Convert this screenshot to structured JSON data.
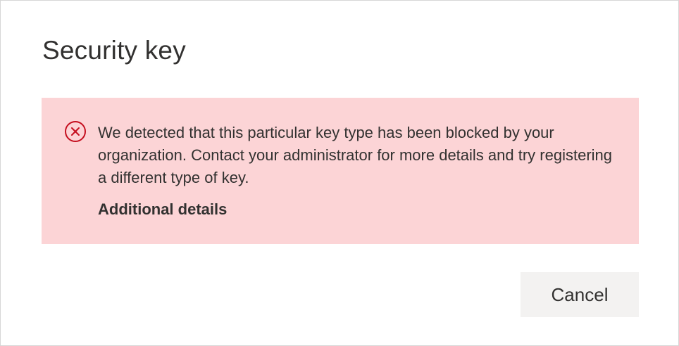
{
  "dialog": {
    "title": "Security key",
    "error": {
      "icon": "error-circle-x-icon",
      "color": "#c50f1f",
      "background": "#fcd4d6",
      "message": "We detected that this particular key type has been blocked by your organization. Contact your administrator for more details and try registering a different type of key.",
      "details_label": "Additional details"
    },
    "cancel_label": "Cancel"
  }
}
